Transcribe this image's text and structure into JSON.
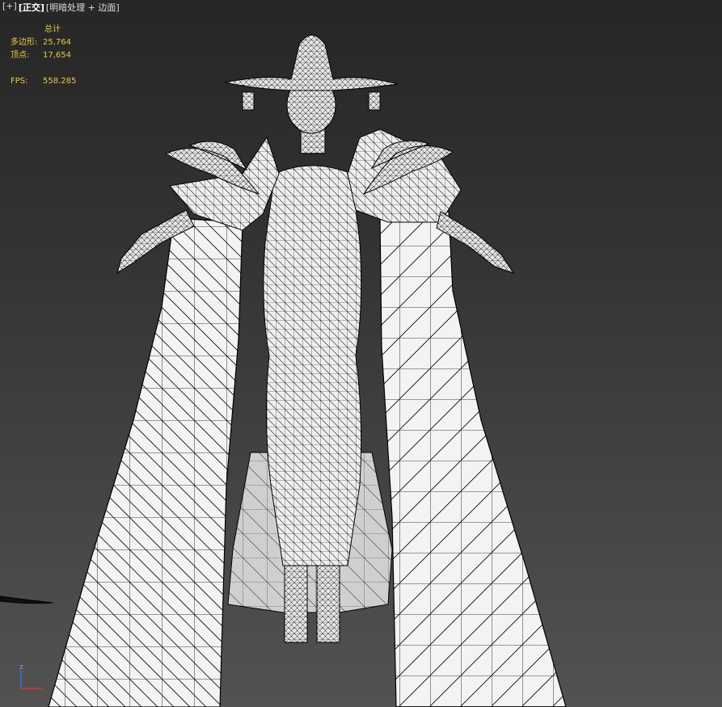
{
  "viewport_label": {
    "plus": "[+]",
    "view": "[正交]",
    "shading": "[明暗处理 + 边面]"
  },
  "stats": {
    "header": "总计",
    "polygons_label": "多边形:",
    "polygons_value": "25,764",
    "vertices_label": "顶点:",
    "vertices_value": "17,654",
    "fps_label": "FPS:",
    "fps_value": "558.285"
  },
  "gizmo": {
    "z_label": "z",
    "x_color": "#e03030",
    "z_color": "#3a6fe0"
  },
  "colors": {
    "mesh_fill": "#f2f2f2",
    "mesh_shadow": "#cfcfcf",
    "wire": "#000000",
    "stats_text": "#e8c84a"
  },
  "model": {
    "name_icon": "wireframe-character-model"
  }
}
